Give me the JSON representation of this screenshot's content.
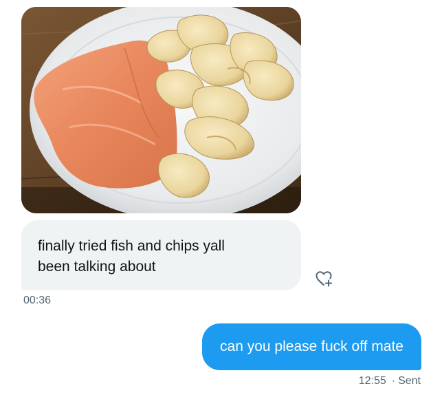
{
  "conversation": {
    "received": {
      "image": {
        "subject": "plate of smoked salmon and potato crisps",
        "icon": "photo"
      },
      "text_lines": [
        "finally tried fish and chips yall",
        "been talking about"
      ],
      "timestamp": "00:36",
      "reaction_icon": "heart-plus-icon"
    },
    "sent": {
      "text": "can you please fuck off mate",
      "timestamp": "12:55",
      "status": "Sent"
    }
  },
  "colors": {
    "sent_bubble": "#1d9bf0",
    "received_bubble": "#eff3f4",
    "meta_text": "#536471",
    "body_text": "#0f1419"
  }
}
